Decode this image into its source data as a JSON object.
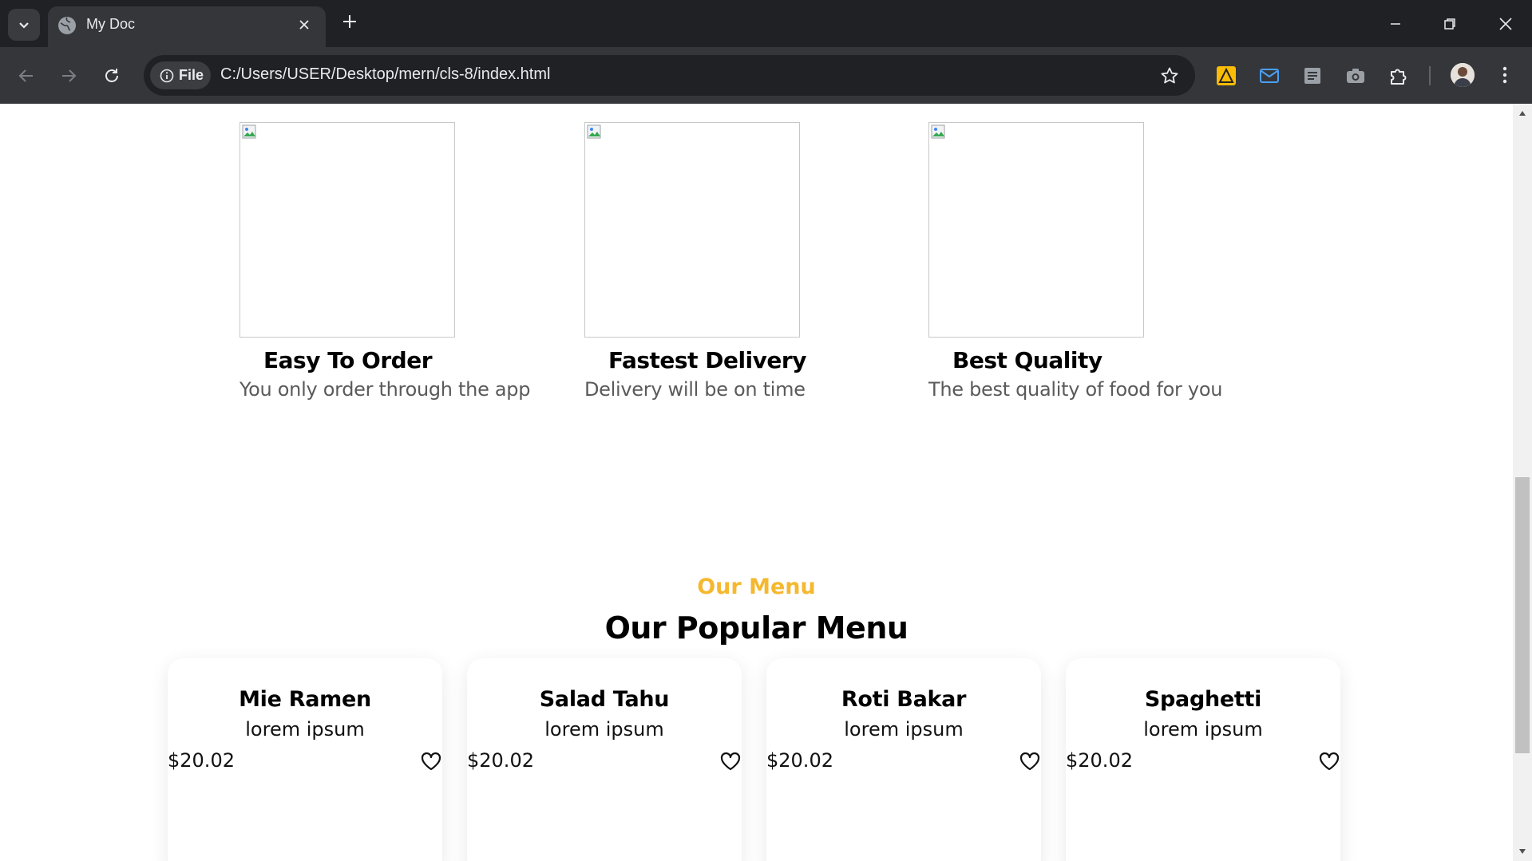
{
  "browser": {
    "tab_title": "My Doc",
    "site_info_label": "File",
    "url": "C:/Users/USER/Desktop/mern/cls-8/index.html"
  },
  "features": [
    {
      "title": "Easy To Order",
      "text": "You only order through the app"
    },
    {
      "title": "Fastest Delivery",
      "text": "Delivery will be on time"
    },
    {
      "title": "Best Quality",
      "text": "The best quality of food for you"
    }
  ],
  "menu": {
    "subtitle": "Our Menu",
    "title": "Our Popular Menu",
    "items": [
      {
        "name": "Mie Ramen",
        "desc": "lorem ipsum",
        "price": "$20.02"
      },
      {
        "name": "Salad Tahu",
        "desc": "lorem ipsum",
        "price": "$20.02"
      },
      {
        "name": "Roti Bakar",
        "desc": "lorem ipsum",
        "price": "$20.02"
      },
      {
        "name": "Spaghetti",
        "desc": "lorem ipsum",
        "price": "$20.02"
      }
    ]
  },
  "colors": {
    "accent": "#f5b82e",
    "chrome_dark": "#202124",
    "chrome_toolbar": "#35363a"
  }
}
